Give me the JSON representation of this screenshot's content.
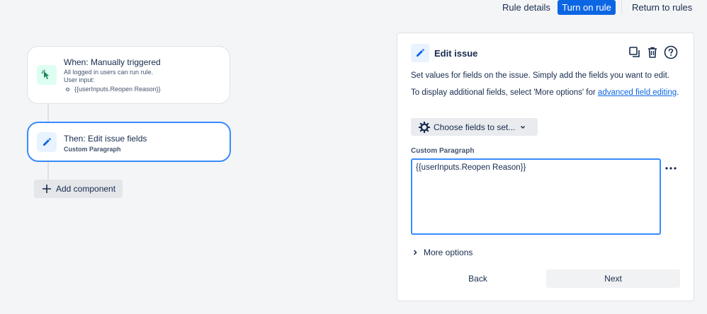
{
  "header": {
    "rule_details": "Rule details",
    "turn_on_rule": "Turn on rule",
    "return_to_rules": "Return to rules"
  },
  "canvas": {
    "trigger": {
      "title": "When: Manually triggered",
      "line1": "All logged in users can run rule.",
      "line2": "User input:",
      "input_item": "{{userInputs.Reopen Reason}}",
      "icon": "cursor-click-icon"
    },
    "action": {
      "title": "Then: Edit issue fields",
      "subtitle": "Custom Paragraph",
      "icon": "pencil-icon"
    },
    "add_component": "Add component"
  },
  "panel": {
    "title": "Edit issue",
    "description": "Set values for fields on the issue. Simply add the fields you want to edit.",
    "additional_prefix": "To display additional fields, select 'More options' for ",
    "additional_link": "advanced field editing",
    "additional_suffix": ".",
    "choose_fields": "Choose fields to set...",
    "field_label": "Custom Paragraph",
    "field_value": "{{userInputs.Reopen Reason}}",
    "more_options": "More options",
    "back": "Back",
    "next": "Next",
    "icons": [
      "copy-icon",
      "trash-icon",
      "help-icon"
    ]
  },
  "colors": {
    "primary": "#0c66e4",
    "focus_border": "#388bff",
    "trigger_icon_bg": "#dcfff1",
    "action_icon_bg": "#e9f2ff"
  }
}
